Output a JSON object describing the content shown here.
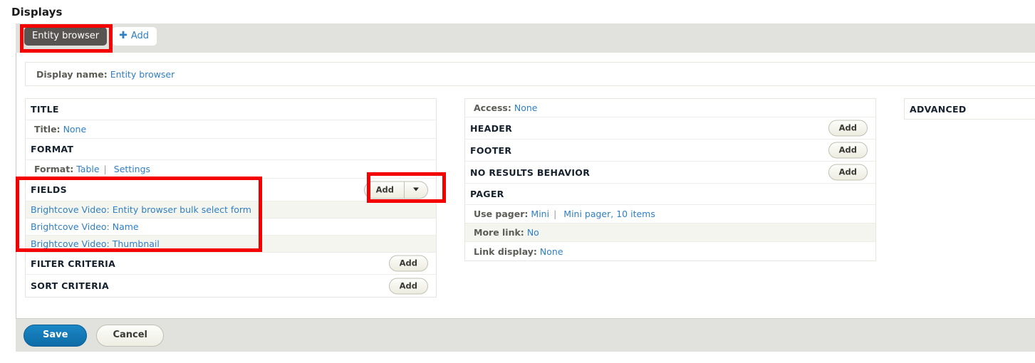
{
  "page": {
    "heading": "Displays"
  },
  "tabs": {
    "items": [
      {
        "label": "Entity browser",
        "active": true
      }
    ],
    "add_label": "Add",
    "add_icon": "plus-icon"
  },
  "display_name": {
    "label": "Display name:",
    "value": "Entity browser"
  },
  "columns": {
    "left": {
      "sections": [
        {
          "title": "TITLE",
          "rows": [
            {
              "label": "Title:",
              "links": [
                "None"
              ],
              "striped": false
            }
          ]
        },
        {
          "title": "FORMAT",
          "rows": [
            {
              "label": "Format:",
              "links": [
                "Table",
                "Settings"
              ],
              "striped": false
            }
          ]
        },
        {
          "title": "FIELDS",
          "button": {
            "label": "Add",
            "has_dropdown": true,
            "dropdown_icon": "chevron-down-icon"
          },
          "items": [
            {
              "label": "Brightcove Video: Entity browser bulk select form",
              "striped": true
            },
            {
              "label": "Brightcove Video: Name",
              "striped": false
            },
            {
              "label": "Brightcove Video: Thumbnail",
              "striped": true
            }
          ]
        },
        {
          "title": "FILTER CRITERIA",
          "button": {
            "label": "Add",
            "has_dropdown": false
          }
        },
        {
          "title": "SORT CRITERIA",
          "button": {
            "label": "Add",
            "has_dropdown": false
          }
        }
      ]
    },
    "middle": {
      "access_row": {
        "label": "Access:",
        "links": [
          "None"
        ]
      },
      "sections": [
        {
          "title": "HEADER",
          "button": {
            "label": "Add"
          }
        },
        {
          "title": "FOOTER",
          "button": {
            "label": "Add"
          }
        },
        {
          "title": "NO RESULTS BEHAVIOR",
          "button": {
            "label": "Add"
          }
        },
        {
          "title": "PAGER",
          "rows": [
            {
              "label": "Use pager:",
              "links": [
                "Mini",
                "Mini pager, 10 items"
              ],
              "striped": false
            },
            {
              "label": "More link:",
              "links": [
                "No"
              ],
              "striped": true
            },
            {
              "label": "Link display:",
              "links": [
                "None"
              ],
              "striped": false
            }
          ]
        }
      ]
    },
    "right": {
      "sections": [
        {
          "title": "ADVANCED"
        }
      ]
    }
  },
  "actions": {
    "save_label": "Save",
    "cancel_label": "Cancel"
  },
  "colors": {
    "link": "#2e7fc4",
    "tab_active_bg": "#575451",
    "toolbar_bg": "#e1e2dd",
    "annotation": "#f50000",
    "primary_button": "#0c6ca6",
    "stripe": "#f5f5f0"
  },
  "annotations": [
    {
      "name": "entity-browser-tab-highlight"
    },
    {
      "name": "fields-section-highlight"
    },
    {
      "name": "fields-add-button-highlight"
    }
  ]
}
